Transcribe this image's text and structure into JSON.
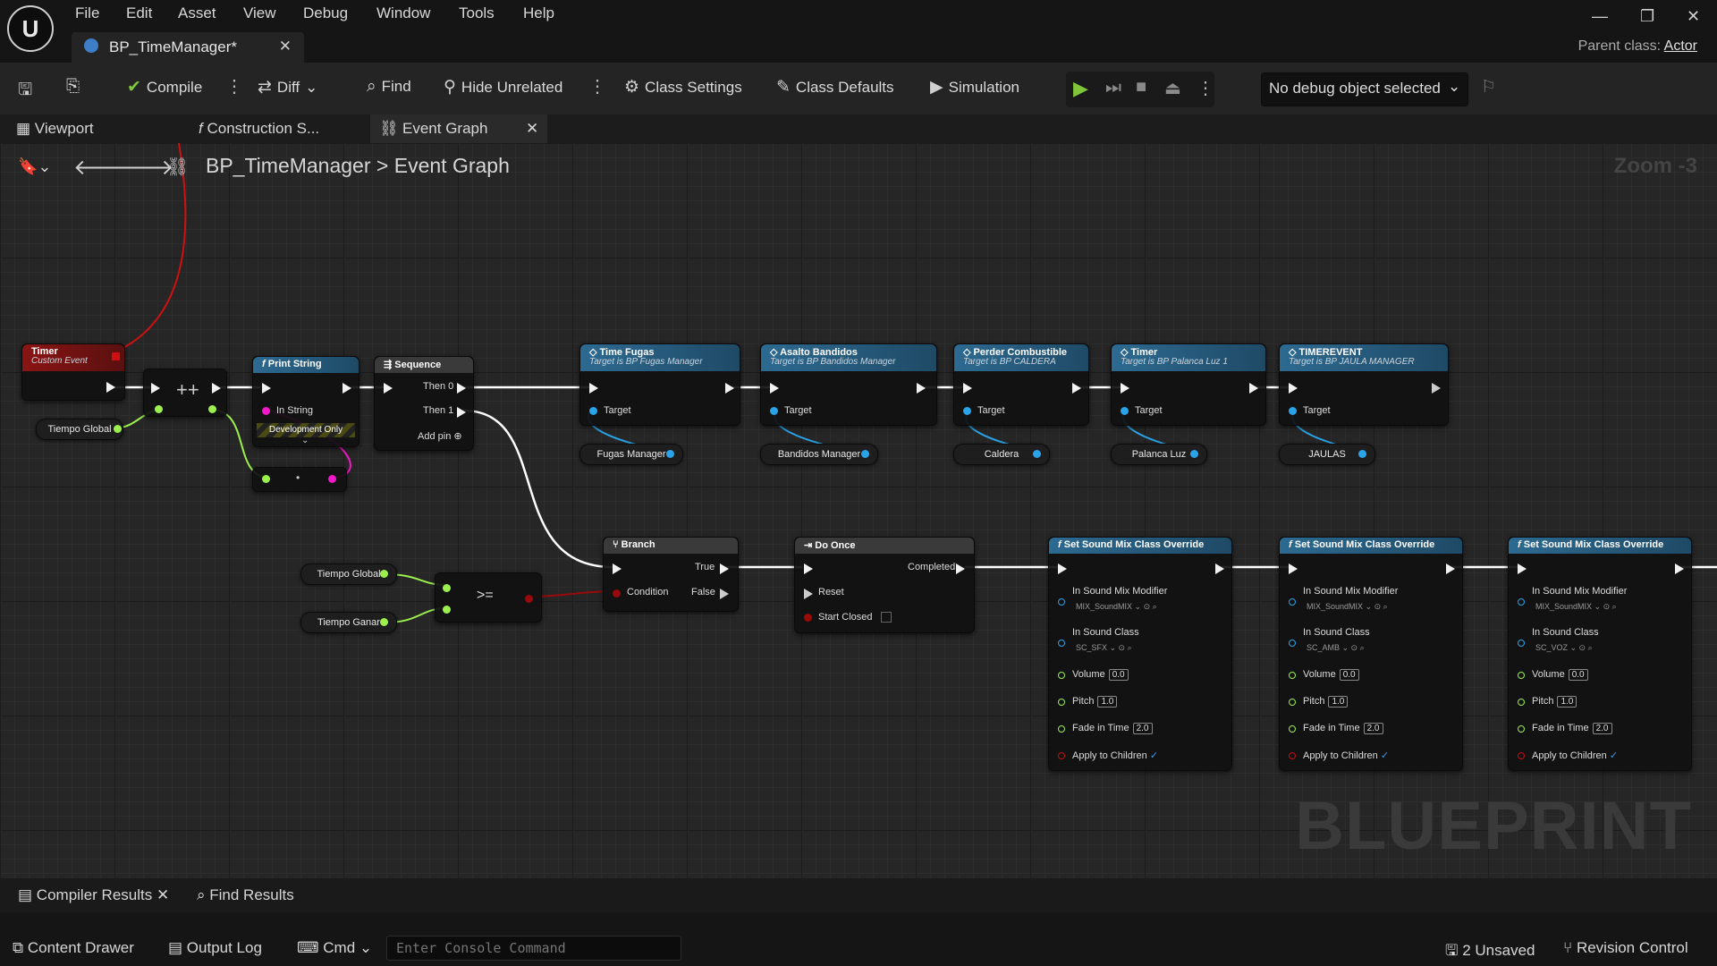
{
  "menubar": {
    "items": [
      "File",
      "Edit",
      "Asset",
      "View",
      "Debug",
      "Window",
      "Tools",
      "Help"
    ],
    "doc_tab": "BP_TimeManager*",
    "parent_class_label": "Parent class:",
    "parent_class_value": "Actor"
  },
  "toolbar": {
    "compile": "Compile",
    "diff": "Diff",
    "find": "Find",
    "hide_unrelated": "Hide Unrelated",
    "class_settings": "Class Settings",
    "class_defaults": "Class Defaults",
    "simulation": "Simulation",
    "debug_object": "No debug object selected",
    "play_color": "#7fc63b"
  },
  "tabs": {
    "viewport": "Viewport",
    "construction": "Construction S...",
    "event_graph": "Event Graph"
  },
  "breadcrumb": {
    "root": "BP_TimeManager",
    "separator": ">",
    "current": "Event Graph",
    "zoom": "Zoom -3"
  },
  "watermark": "BLUEPRINT",
  "nodes": {
    "timer_event": {
      "title": "Timer",
      "subtitle": "Custom Event"
    },
    "tiempo_global_1": "Tiempo Global",
    "print_string": {
      "title": "Print String",
      "in_string": "In String",
      "dev_only": "Development Only"
    },
    "sequence": {
      "title": "Sequence",
      "then0": "Then 0",
      "then1": "Then 1",
      "add_pin": "Add pin"
    },
    "calls": [
      {
        "title": "Time Fugas",
        "subtitle": "Target is BP Fugas Manager",
        "target": "Target",
        "var": "Fugas Manager"
      },
      {
        "title": "Asalto Bandidos",
        "subtitle": "Target is BP Bandidos Manager",
        "target": "Target",
        "var": "Bandidos Manager"
      },
      {
        "title": "Perder Combustible",
        "subtitle": "Target is BP CALDERA",
        "target": "Target",
        "var": "Caldera"
      },
      {
        "title": "Timer",
        "subtitle": "Target is BP Palanca Luz 1",
        "target": "Target",
        "var": "Palanca Luz"
      },
      {
        "title": "TIMEREVENT",
        "subtitle": "Target is BP JAULA MANAGER",
        "target": "Target",
        "var": "JAULAS"
      }
    ],
    "tiempo_global_2": "Tiempo Global",
    "tiempo_ganar": "Tiempo Ganar",
    "compare_op": ">=",
    "branch": {
      "title": "Branch",
      "condition": "Condition",
      "true": "True",
      "false": "False"
    },
    "do_once": {
      "title": "Do Once",
      "completed": "Completed",
      "reset": "Reset",
      "start_closed": "Start Closed"
    },
    "sound_mix": [
      {
        "title": "Set Sound Mix Class Override",
        "modifier_label": "In Sound Mix Modifier",
        "modifier": "MIX_SoundMIX",
        "class_label": "In Sound Class",
        "class": "SC_SFX",
        "volume_label": "Volume",
        "volume": "0.0",
        "pitch_label": "Pitch",
        "pitch": "1.0",
        "fade_label": "Fade in Time",
        "fade": "2.0",
        "apply_label": "Apply to Children",
        "check": "✓"
      },
      {
        "title": "Set Sound Mix Class Override",
        "modifier_label": "In Sound Mix Modifier",
        "modifier": "MIX_SoundMIX",
        "class_label": "In Sound Class",
        "class": "SC_AMB",
        "volume_label": "Volume",
        "volume": "0.0",
        "pitch_label": "Pitch",
        "pitch": "1.0",
        "fade_label": "Fade in Time",
        "fade": "2.0",
        "apply_label": "Apply to Children",
        "check": "✓"
      },
      {
        "title": "Set Sound Mix Class Override",
        "modifier_label": "In Sound Mix Modifier",
        "modifier": "MIX_SoundMIX",
        "class_label": "In Sound Class",
        "class": "SC_VOZ",
        "volume_label": "Volume",
        "volume": "0.0",
        "pitch_label": "Pitch",
        "pitch": "1.0",
        "fade_label": "Fade in Time",
        "fade": "2.0",
        "apply_label": "Apply to Children",
        "check": "✓"
      }
    ]
  },
  "bottom_tabs": {
    "compiler_results": "Compiler Results",
    "find_results": "Find Results"
  },
  "statusbar": {
    "content_drawer": "Content Drawer",
    "output_log": "Output Log",
    "cmd": "Cmd",
    "console_placeholder": "Enter Console Command",
    "unsaved": "2 Unsaved",
    "revision_control": "Revision Control"
  },
  "colors": {
    "event_header": "#8a1414",
    "function_header": "#2d6a91",
    "exec_wire": "#ffffff",
    "float_pin": "#9cf04e",
    "string_pin": "#f018c8",
    "object_pin": "#2aa3e8",
    "bool_pin": "#8f0c0c"
  }
}
